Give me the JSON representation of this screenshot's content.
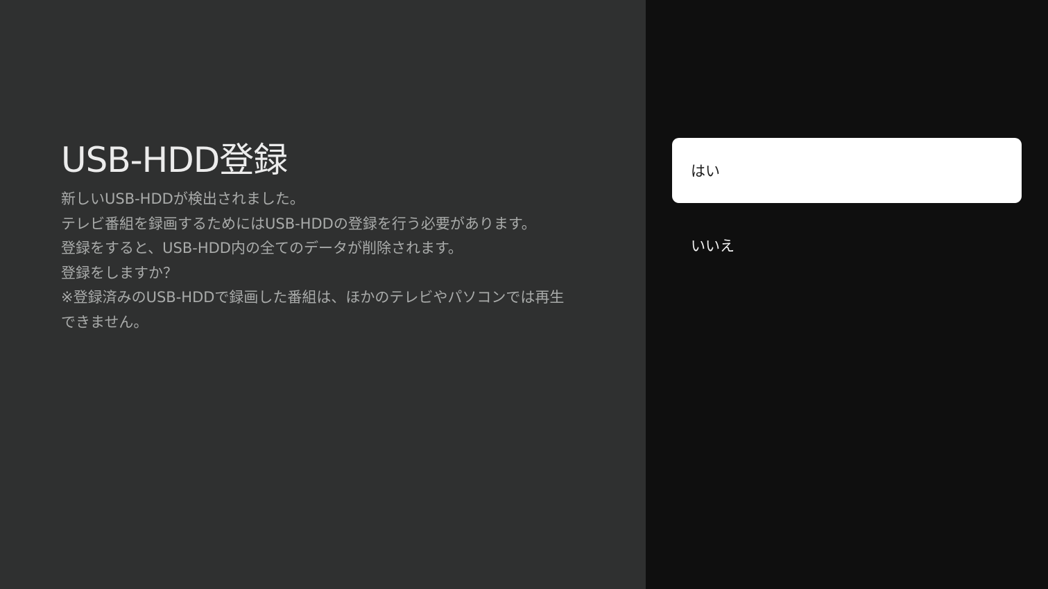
{
  "dialog": {
    "title": "USB-HDD登録",
    "description_lines": [
      "新しいUSB-HDDが検出されました。",
      "テレビ番組を録画するためにはUSB-HDDの登録を行う必要があります。",
      "登録をすると、USB-HDD内の全てのデータが削除されます。",
      "登録をしますか？",
      "※登録済みのUSB-HDDで録画した番組は、ほかのテレビやパソコンでは再生",
      "できません。"
    ]
  },
  "options": {
    "yes_label": "はい",
    "no_label": "いいえ",
    "selected": "はい"
  },
  "colors": {
    "left_background": "#2f3030",
    "right_background": "#0f0f0f",
    "selected_option_background": "#ffffff"
  }
}
